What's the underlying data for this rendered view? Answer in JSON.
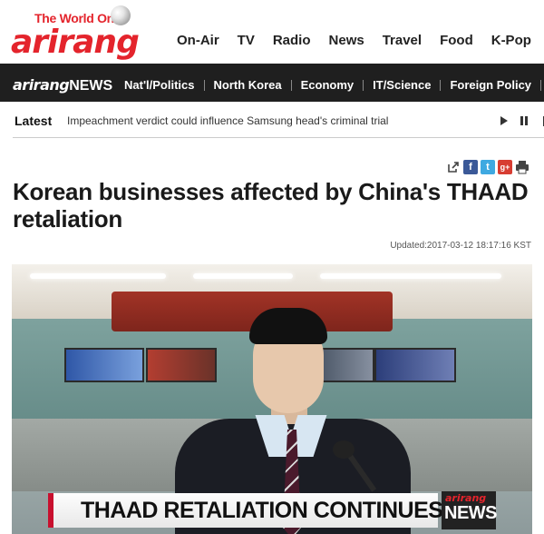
{
  "header": {
    "tagline": "The World On",
    "brand": "arirang",
    "nav": [
      "On-Air",
      "TV",
      "Radio",
      "News",
      "Travel",
      "Food",
      "K-Pop",
      "L"
    ]
  },
  "news_bar": {
    "brand": "arirang",
    "label": "NEWS",
    "categories": [
      "Nat'l/Politics",
      "North Korea",
      "Economy",
      "IT/Science",
      "Foreign Policy",
      "W"
    ]
  },
  "latest": {
    "label": "Latest",
    "headline": "Impeachment verdict could influence Samsung head's criminal trial"
  },
  "article": {
    "title": "Korean businesses affected by China's THAAD retaliation",
    "updated": "Updated:2017-03-12 18:17:16 KST"
  },
  "video": {
    "lower_third": "THAAD RETALIATION CONTINUES",
    "corner_brand": "arirang",
    "corner_label": "NEWS"
  },
  "colors": {
    "brand_red": "#e4242c",
    "news_bar_bg": "#1f1f1f",
    "facebook": "#3b5998",
    "twitter": "#3fa9e1",
    "googleplus": "#d73d32"
  }
}
